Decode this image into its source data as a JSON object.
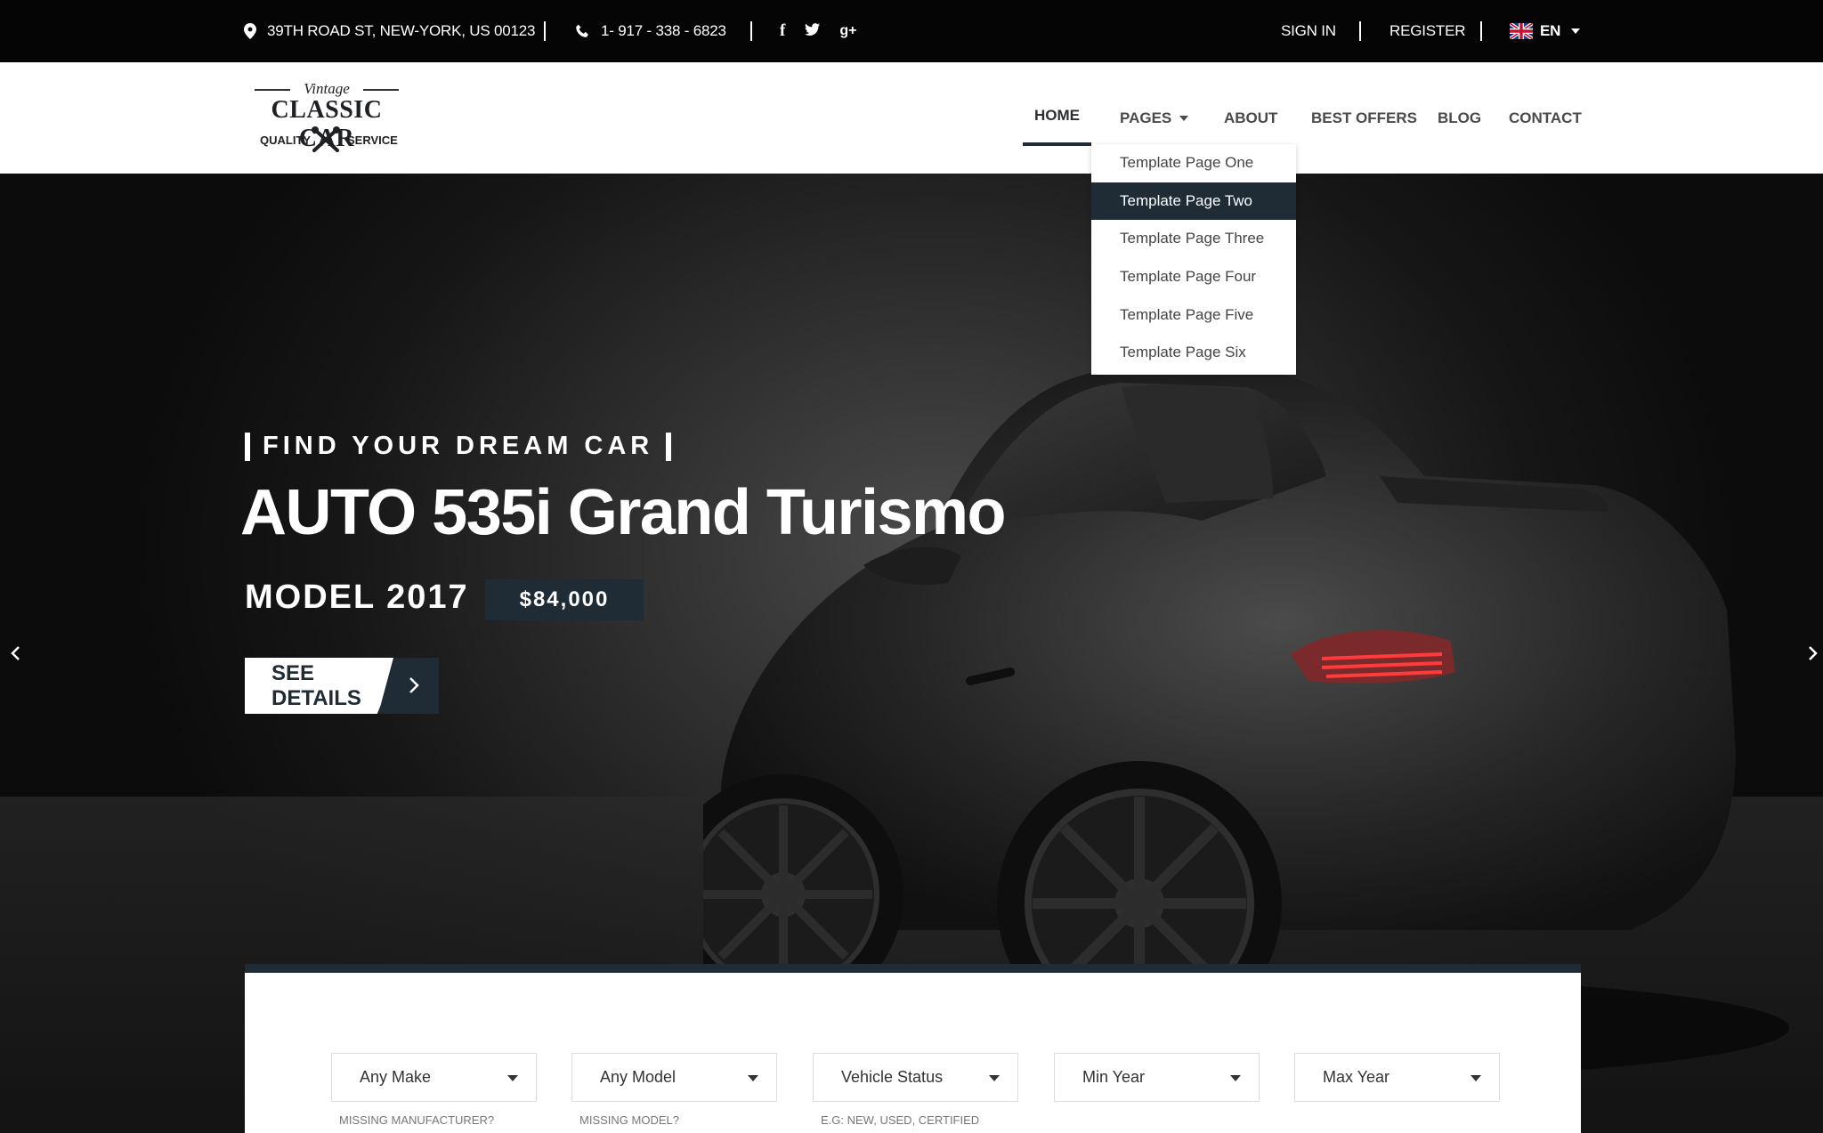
{
  "topbar": {
    "address": "39TH ROAD ST, NEW-YORK, US 00123",
    "phone": "1- 917 - 338 - 6823",
    "social": {
      "facebook": "f",
      "twitter": "t",
      "google": "g+"
    },
    "sign_in": "SIGN IN",
    "register": "REGISTER",
    "language": "EN"
  },
  "logo": {
    "top": "Vintage",
    "brand": "CLASSIC CAR",
    "left": "QUALITY",
    "right": "SERVICE"
  },
  "nav": {
    "home": "HOME",
    "pages": "PAGES",
    "about": "ABOUT",
    "best_offers": "BEST OFFERS",
    "blog": "BLOG",
    "contact": "CONTACT"
  },
  "dropdown": {
    "items": [
      "Template Page One",
      "Template Page Two",
      "Template Page Three",
      "Template Page Four",
      "Template Page Five",
      "Template Page Six"
    ],
    "highlighted": "Template Page Two"
  },
  "hero": {
    "eyebrow": "FIND YOUR DREAM CAR",
    "title": "AUTO 535i Grand Turismo",
    "model": "MODEL 2017",
    "price": "$84,000",
    "button": "SEE DETAILS"
  },
  "search": {
    "make": "Any Make",
    "model": "Any Model",
    "status": "Vehicle Status",
    "min_year": "Min Year",
    "max_year": "Max Year",
    "hint_make": "MISSING MANUFACTURER?",
    "hint_model": "MISSING MODEL?",
    "hint_status": "E.G:  NEW, USED, CERTIFIED"
  },
  "colors": {
    "accent": "#1f2b35",
    "topbar": "#050505"
  }
}
